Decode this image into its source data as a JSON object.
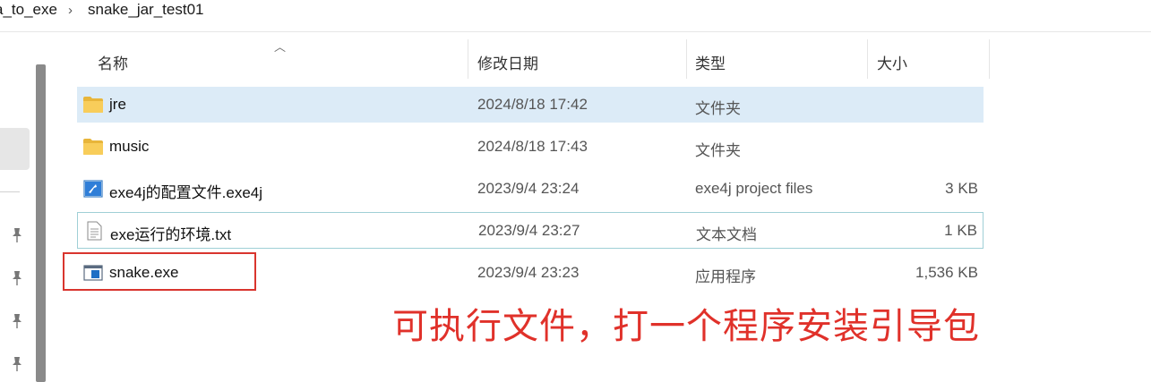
{
  "breadcrumb": {
    "items": [
      "a_to_exe",
      "snake_jar_test01"
    ],
    "separator": "›"
  },
  "columns": {
    "name": "名称",
    "date": "修改日期",
    "type": "类型",
    "size": "大小"
  },
  "files": [
    {
      "name": "jre",
      "date": "2024/8/18 17:42",
      "type": "文件夹",
      "size": "",
      "icon": "folder-icon"
    },
    {
      "name": "music",
      "date": "2024/8/18 17:43",
      "type": "文件夹",
      "size": "",
      "icon": "folder-icon"
    },
    {
      "name": "exe4j的配置文件.exe4j",
      "date": "2023/9/4 23:24",
      "type": "exe4j project files",
      "size": "3 KB",
      "icon": "exe4j-project-icon"
    },
    {
      "name": "exe运行的环境.txt",
      "date": "2023/9/4 23:27",
      "type": "文本文档",
      "size": "1 KB",
      "icon": "text-document-icon"
    },
    {
      "name": "snake.exe",
      "date": "2023/9/4 23:23",
      "type": "应用程序",
      "size": "1,536 KB",
      "icon": "application-icon"
    }
  ],
  "annotation": {
    "text": "可执行文件，打一个程序安装引导包",
    "color": "#e0312a"
  },
  "colors": {
    "selected_row": "#dcebf7",
    "highlight_border": "#d9352e",
    "folder": "#f4c542"
  }
}
